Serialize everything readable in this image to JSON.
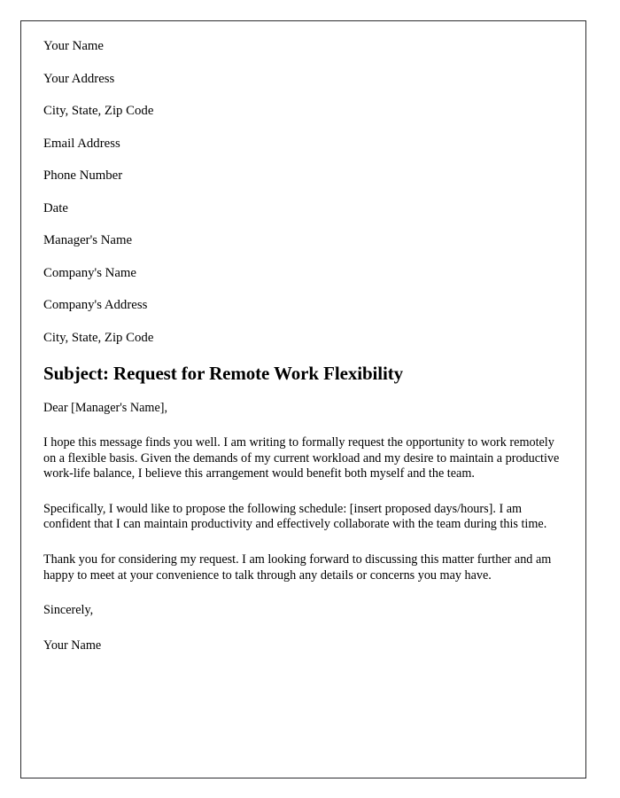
{
  "document": {
    "type": "letter",
    "header_lines": [
      "Your Name",
      "Your Address",
      "City, State, Zip Code",
      "Email Address",
      "Phone Number",
      "Date",
      "Manager's Name",
      "Company's Name",
      "Company's Address",
      "City, State, Zip Code"
    ],
    "subject": "Subject: Request for Remote Work Flexibility",
    "salutation": "Dear [Manager's Name],",
    "paragraphs": [
      "I hope this message finds you well. I am writing to formally request the opportunity to work remotely on a flexible basis. Given the demands of my current workload and my desire to maintain a productive work-life balance, I believe this arrangement would benefit both myself and the team.",
      "Specifically, I would like to propose the following schedule: [insert proposed days/hours]. I am confident that I can maintain productivity and effectively collaborate with the team during this time.",
      "Thank you for considering my request. I am looking forward to discussing this matter further and am happy to meet at your convenience to talk through any details or concerns you may have."
    ],
    "closing": "Sincerely,",
    "signature": "Your Name"
  },
  "colors": {
    "page_background": "#ffffff",
    "page_border": "#2b2b2e",
    "text": "#000000"
  }
}
